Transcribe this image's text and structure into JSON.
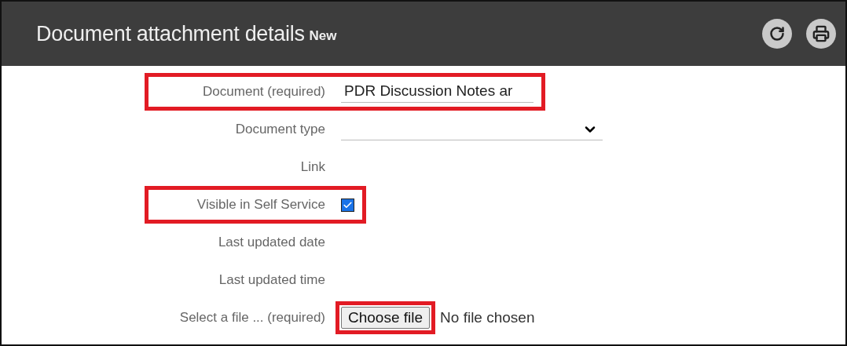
{
  "header": {
    "title": "Document attachment details",
    "badge": "New"
  },
  "fields": [
    {
      "kind": "text",
      "label": "Document",
      "note": "(required)",
      "value": "PDR Discussion Notes ar",
      "highlighted": true
    },
    {
      "kind": "select",
      "label": "Document type",
      "highlighted": false
    },
    {
      "kind": "empty",
      "label": "Link",
      "highlighted": false
    },
    {
      "kind": "checkbox",
      "label": "Visible in Self Service",
      "checked": true,
      "highlighted": true
    },
    {
      "kind": "empty",
      "label": "Last updated date",
      "highlighted": false
    },
    {
      "kind": "empty",
      "label": "Last updated time",
      "highlighted": false
    },
    {
      "kind": "file",
      "label": "Select a file ...",
      "note": "(required)",
      "button": "Choose file",
      "status": "No file chosen",
      "highlighted": true
    }
  ]
}
